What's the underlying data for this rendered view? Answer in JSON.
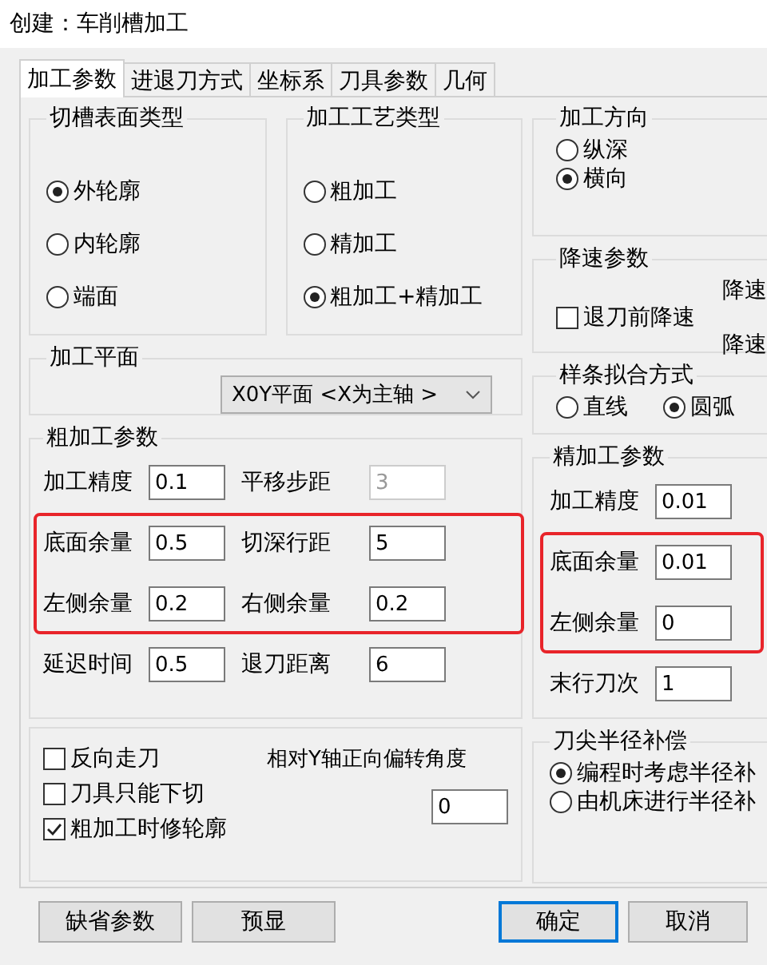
{
  "window": {
    "title": "创建：车削槽加工"
  },
  "tabs": [
    {
      "label": "加工参数",
      "selected": true
    },
    {
      "label": "进退刀方式",
      "selected": false
    },
    {
      "label": "坐标系",
      "selected": false
    },
    {
      "label": "刀具参数",
      "selected": false
    },
    {
      "label": "几何",
      "selected": false
    }
  ],
  "groove_surface_type": {
    "title": "切槽表面类型",
    "options": [
      {
        "label": "外轮廓",
        "selected": true
      },
      {
        "label": "内轮廓",
        "selected": false
      },
      {
        "label": "端面",
        "selected": false
      }
    ]
  },
  "process_type": {
    "title": "加工工艺类型",
    "options": [
      {
        "label": "粗加工",
        "selected": false
      },
      {
        "label": "精加工",
        "selected": false
      },
      {
        "label": "粗加工+精加工",
        "selected": true
      }
    ]
  },
  "machining_plane": {
    "title": "加工平面",
    "dropdown": {
      "value": "X0Y平面 <X为主轴 >"
    }
  },
  "rough_params": {
    "title": "粗加工参数",
    "row_groups": [
      {
        "highlighted": false,
        "rows": [
          [
            {
              "label": "加工精度",
              "value": "0.1",
              "disabled": false
            },
            {
              "label": "平移步距",
              "value": "3",
              "disabled": true
            }
          ]
        ]
      },
      {
        "highlighted": true,
        "rows": [
          [
            {
              "label": "底面余量",
              "value": "0.5",
              "disabled": false
            },
            {
              "label": "切深行距",
              "value": "5",
              "disabled": false
            }
          ],
          [
            {
              "label": "左侧余量",
              "value": "0.2",
              "disabled": false
            },
            {
              "label": "右侧余量",
              "value": "0.2",
              "disabled": false
            }
          ]
        ]
      },
      {
        "highlighted": false,
        "rows": [
          [
            {
              "label": "延迟时间",
              "value": "0.5",
              "disabled": false
            },
            {
              "label": "退刀距离",
              "value": "6",
              "disabled": false
            }
          ]
        ]
      }
    ]
  },
  "options": {
    "checkboxes": [
      {
        "label": "反向走刀",
        "checked": false
      },
      {
        "label": "刀具只能下切",
        "checked": false
      },
      {
        "label": "粗加工时修轮廓",
        "checked": true
      }
    ],
    "angle": {
      "label": "相对Y轴正向偏转角度",
      "value": "0"
    }
  },
  "direction": {
    "title": "加工方向",
    "options": [
      {
        "label": "纵深",
        "selected": false
      },
      {
        "label": "横向",
        "selected": true
      }
    ]
  },
  "slowdown": {
    "title": "降速参数",
    "checkbox": {
      "label": "退刀前降速",
      "checked": false
    },
    "labels": [
      "降速",
      "降速"
    ]
  },
  "spline_fit": {
    "title": "样条拟合方式",
    "options": [
      {
        "label": "直线",
        "selected": false
      },
      {
        "label": "圆弧",
        "selected": true
      }
    ]
  },
  "finish_params": {
    "title": "精加工参数",
    "row_groups": [
      {
        "highlighted": false,
        "rows": [
          [
            {
              "label": "加工精度",
              "value": "0.01",
              "disabled": false
            }
          ]
        ]
      },
      {
        "highlighted": true,
        "rows": [
          [
            {
              "label": "底面余量",
              "value": "0.01",
              "disabled": false
            }
          ],
          [
            {
              "label": "左侧余量",
              "value": "0",
              "disabled": false
            }
          ]
        ]
      },
      {
        "highlighted": false,
        "rows": [
          [
            {
              "label": "末行刀次",
              "value": "1",
              "disabled": false
            }
          ]
        ]
      }
    ]
  },
  "tip_compensation": {
    "title": "刀尖半径补偿",
    "options": [
      {
        "label": "编程时考虑半径补",
        "selected": true
      },
      {
        "label": "由机床进行半径补",
        "selected": false
      }
    ]
  },
  "buttons_left": [
    {
      "label": "缺省参数",
      "default": false
    },
    {
      "label": "预显",
      "default": false
    }
  ],
  "buttons_right": [
    {
      "label": "确定",
      "default": true
    },
    {
      "label": "取消",
      "default": false
    }
  ]
}
